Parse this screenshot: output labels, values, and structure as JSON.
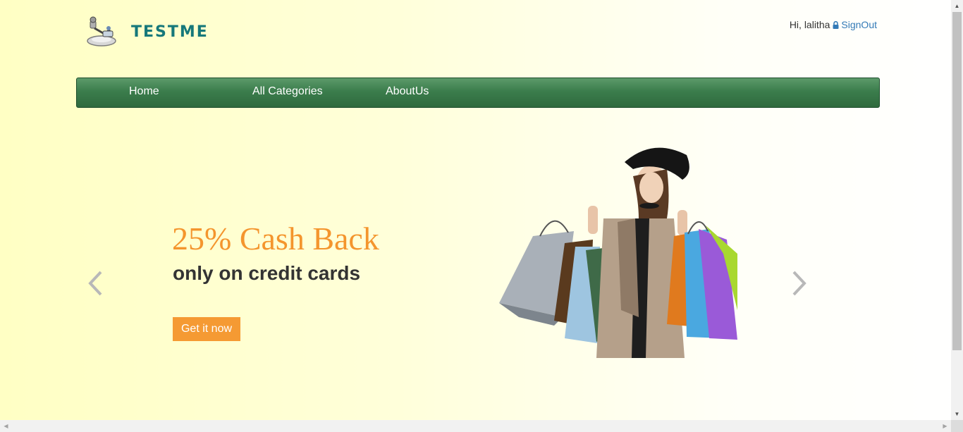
{
  "header": {
    "logo_text": "TESTME",
    "greeting": "Hi, lalitha",
    "signout_label": "SignOut"
  },
  "nav": {
    "items": [
      {
        "label": "Home"
      },
      {
        "label": "All Categories"
      },
      {
        "label": "AboutUs"
      }
    ]
  },
  "carousel": {
    "headline": "25% Cash Back",
    "subline": "only on credit cards",
    "cta_label": "Get it now",
    "prev_icon": "chevron-left-icon",
    "next_icon": "chevron-right-icon"
  },
  "colors": {
    "accent": "#f59a33",
    "nav_green": "#3b7d4c",
    "logo_teal": "#16787a",
    "link": "#337ab7"
  }
}
